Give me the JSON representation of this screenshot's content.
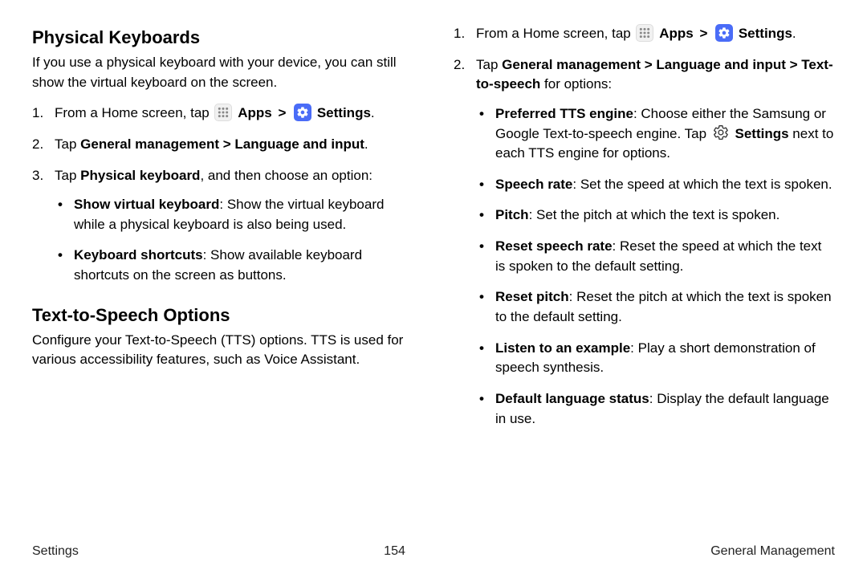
{
  "left": {
    "h1": "Physical Keyboards",
    "p1": "If you use a physical keyboard with your device, you can still show the virtual keyboard on the screen.",
    "step1_a": "From a Home screen, tap ",
    "step1_apps": "Apps",
    "step1_chev": ">",
    "step1_settings": "Settings",
    "step1_end": ".",
    "step2_a": "Tap ",
    "step2_b": "General management > Language and input",
    "step2_c": ".",
    "step3_a": "Tap ",
    "step3_b": "Physical keyboard",
    "step3_c": ", and then choose an option:",
    "bul1_b": "Show virtual keyboard",
    "bul1_t": ": Show the virtual keyboard while a physical keyboard is also being used.",
    "bul2_b": "Keyboard shortcuts",
    "bul2_t": ": Show available keyboard shortcuts on the screen as buttons.",
    "h2": "Text-to-Speech Options",
    "p2": "Configure your Text-to-Speech (TTS) options. TTS is used for various accessibility features, such as Voice Assistant."
  },
  "right": {
    "step1_a": "From a Home screen, tap ",
    "step1_apps": "Apps",
    "step1_chev": ">",
    "step1_settings": "Settings",
    "step1_end": ".",
    "step2_a": "Tap ",
    "step2_b": "General management > Language and input > Text-to-speech",
    "step2_c": " for options:",
    "bul1_b": "Preferred TTS engine",
    "bul1_t1": ": Choose either the Samsung or Google Text-to-speech engine. Tap ",
    "bul1_settings": "Settings",
    "bul1_t2": " next to each TTS engine for options.",
    "bul2_b": "Speech rate",
    "bul2_t": ": Set the speed at which the text is spoken.",
    "bul3_b": "Pitch",
    "bul3_t": ": Set the pitch at which the text is spoken.",
    "bul4_b": "Reset speech rate",
    "bul4_t": ": Reset the speed at which the text is spoken to the default setting.",
    "bul5_b": "Reset pitch",
    "bul5_t": ": Reset the pitch at which the text is spoken to the default setting.",
    "bul6_b": "Listen to an example",
    "bul6_t": ": Play a short demonstration of speech synthesis.",
    "bul7_b": "Default language status",
    "bul7_t": ": Display the default language in use."
  },
  "footer": {
    "left": "Settings",
    "center": "154",
    "right": "General Management"
  }
}
